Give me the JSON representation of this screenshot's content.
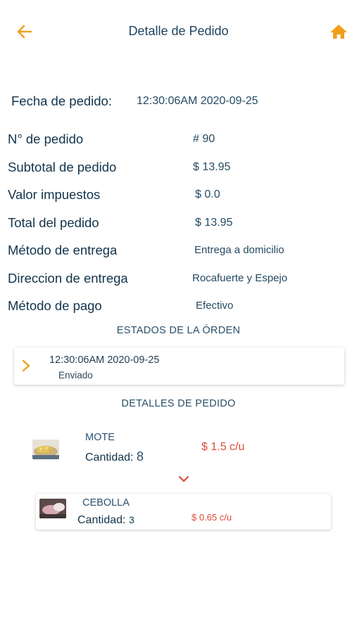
{
  "header": {
    "title": "Detalle de Pedido",
    "back_icon": "arrow-left-icon",
    "home_icon": "home-icon",
    "accent_color": "#f0a01c"
  },
  "order": {
    "date_label": "Fecha de pedido:",
    "date_value": "12:30:06AM 2020-09-25",
    "fields": [
      {
        "label": "N° de pedido",
        "value": "# 90"
      },
      {
        "label": "Subtotal de pedido",
        "value": "$ 13.95"
      },
      {
        "label": "Valor impuestos",
        "value": "$ 0.0"
      },
      {
        "label": "Total del pedido",
        "value": "$ 13.95"
      },
      {
        "label": "Método de entrega",
        "value": "Entrega a domicilio"
      },
      {
        "label": "Direccion de entrega",
        "value": "Rocafuerte y Espejo"
      },
      {
        "label": "Método de pago",
        "value": "Efectivo"
      }
    ]
  },
  "states": {
    "heading": "ESTADOS DE LA ÓRDEN",
    "items": [
      {
        "time": "12:30:06AM 2020-09-25",
        "status": "Enviado"
      }
    ]
  },
  "details": {
    "heading": "DETALLES DE PEDIDO",
    "qty_label": "Cantidad:",
    "items": [
      {
        "name": "MOTE",
        "quantity": "8",
        "price": "$ 1.5  c/u"
      },
      {
        "name": "CEBOLLA",
        "quantity": "3",
        "price": "$ 0.65 c/u"
      }
    ],
    "price_color": "#e04a3a"
  }
}
